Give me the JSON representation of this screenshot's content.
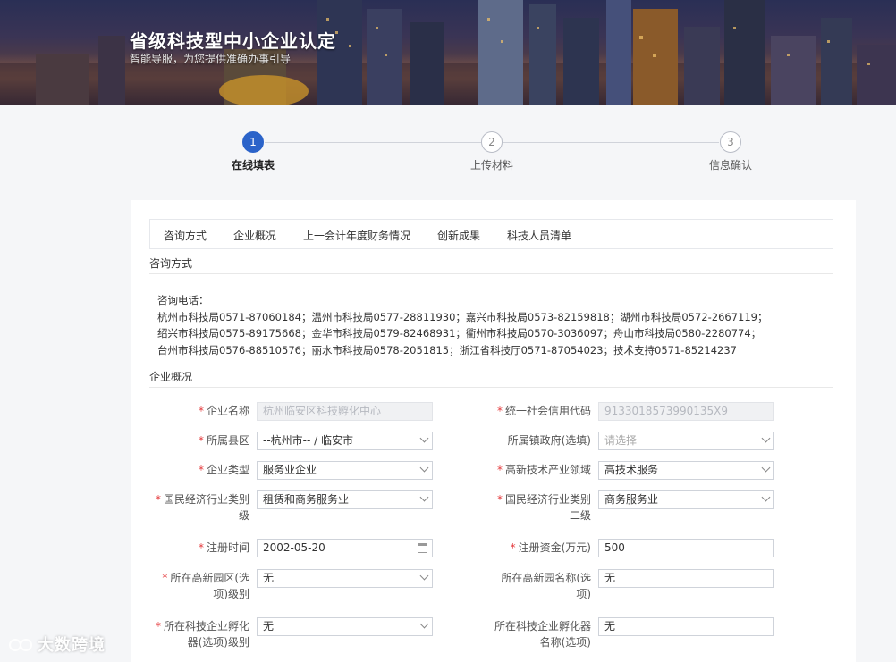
{
  "banner": {
    "title": "省级科技型中小企业认定",
    "subtitle": "智能导服，为您提供准确办事引导"
  },
  "steps": [
    {
      "number": "1",
      "label": "在线填表",
      "active": true
    },
    {
      "number": "2",
      "label": "上传材料",
      "active": false
    },
    {
      "number": "3",
      "label": "信息确认",
      "active": false
    }
  ],
  "tabs": [
    "咨询方式",
    "企业概况",
    "上一会计年度财务情况",
    "创新成果",
    "科技人员清单"
  ],
  "consult": {
    "section_title": "咨询方式",
    "heading": "咨询电话：",
    "lines": [
      "杭州市科技局0571-87060184；温州市科技局0577-28811930；嘉兴市科技局0573-82159818；湖州市科技局0572-2667119；",
      "绍兴市科技局0575-89175668；金华市科技局0579-82468931；衢州市科技局0570-3036097；舟山市科技局0580-2280774；",
      "台州市科技局0576-88510576；丽水市科技局0578-2051815；浙江省科技厅0571-87054023；技术支持0571-85214237"
    ]
  },
  "company": {
    "section_title": "企业概况",
    "fields": {
      "name": {
        "label": "企业名称",
        "value": "杭州临安区科技孵化中心"
      },
      "credit_code": {
        "label": "统一社会信用代码",
        "value": "91330185739901​35X9"
      },
      "county": {
        "label": "所属县区",
        "value": "--杭州市-- / 临安市"
      },
      "town_gov": {
        "label": "所属镇政府(选填)",
        "placeholder": "请选择"
      },
      "company_type": {
        "label": "企业类型",
        "value": "服务业企业"
      },
      "hightech_field": {
        "label": "高新技术产业领域",
        "value": "高技术服务"
      },
      "industry_l1": {
        "label1": "国民经济行业类别",
        "label2": "一级",
        "value": "租赁和商务服务业"
      },
      "industry_l2": {
        "label1": "国民经济行业类别",
        "label2": "二级",
        "value": "商务服务业"
      },
      "reg_date": {
        "label": "注册时间",
        "value": "2002-05-20"
      },
      "reg_capital": {
        "label": "注册资金(万元)",
        "value": "500"
      },
      "park_level": {
        "label1": "所在高新园区(选",
        "label2": "项)级别",
        "value": "无"
      },
      "park_name": {
        "label1": "所在高新园名称(选",
        "label2": "项)",
        "value": "无"
      },
      "incubator_level": {
        "label1": "所在科技企业孵化",
        "label2": "器(选项)级别",
        "value": "无"
      },
      "incubator_name": {
        "label1": "所在科技企业孵化器",
        "label2": "名称(选项)",
        "value": "无"
      }
    }
  },
  "watermark": "大数跨境",
  "colors": {
    "accent": "#2b63c9",
    "required": "#e4393c"
  }
}
